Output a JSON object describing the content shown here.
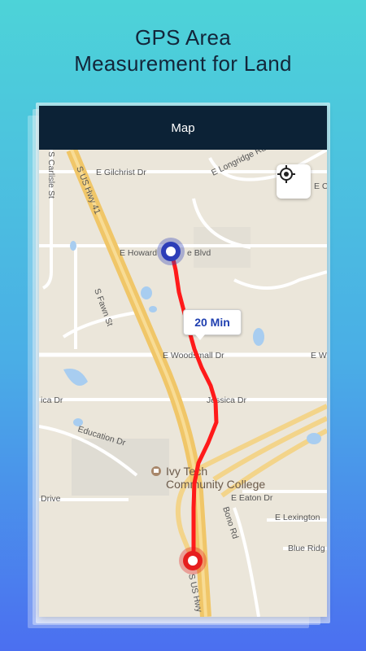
{
  "promo": {
    "title_line1": "GPS Area",
    "title_line2": "Measurement for Land"
  },
  "appbar": {
    "title": "Map"
  },
  "route": {
    "duration_label": "20 Min",
    "start_color": "#2d3eb8",
    "end_color": "#e61e1e",
    "line_color": "#ff1a1a"
  },
  "map": {
    "locate_icon": "gps-crosshair-icon",
    "poi_icon": "school-icon",
    "labels": {
      "carlisle": "S Carlisle St",
      "us_hwy_41": "S US Hwy 41",
      "gilchrist": "E Gilchrist Dr",
      "longridge": "E Longridge Rd",
      "howard": "E Howard",
      "howard_end": "e Blvd",
      "fawn": "S Fawn St",
      "woodsmall": "E Woodsmall Dr",
      "woodsmall_right": "E W",
      "jessica": "Jessica Dr",
      "jessica_left": "ica Dr",
      "education": "Education Dr",
      "ivy_line1": "Ivy Tech",
      "ivy_line2": "Community College",
      "eaton": "E Eaton Dr",
      "bono": "Bono Rd",
      "lexington": "E Lexington",
      "blue_ridge": "Blue Ridg",
      "drive": "Drive",
      "us_hwy_bottom": "S US Hwy",
      "corner_right": "E C"
    }
  }
}
